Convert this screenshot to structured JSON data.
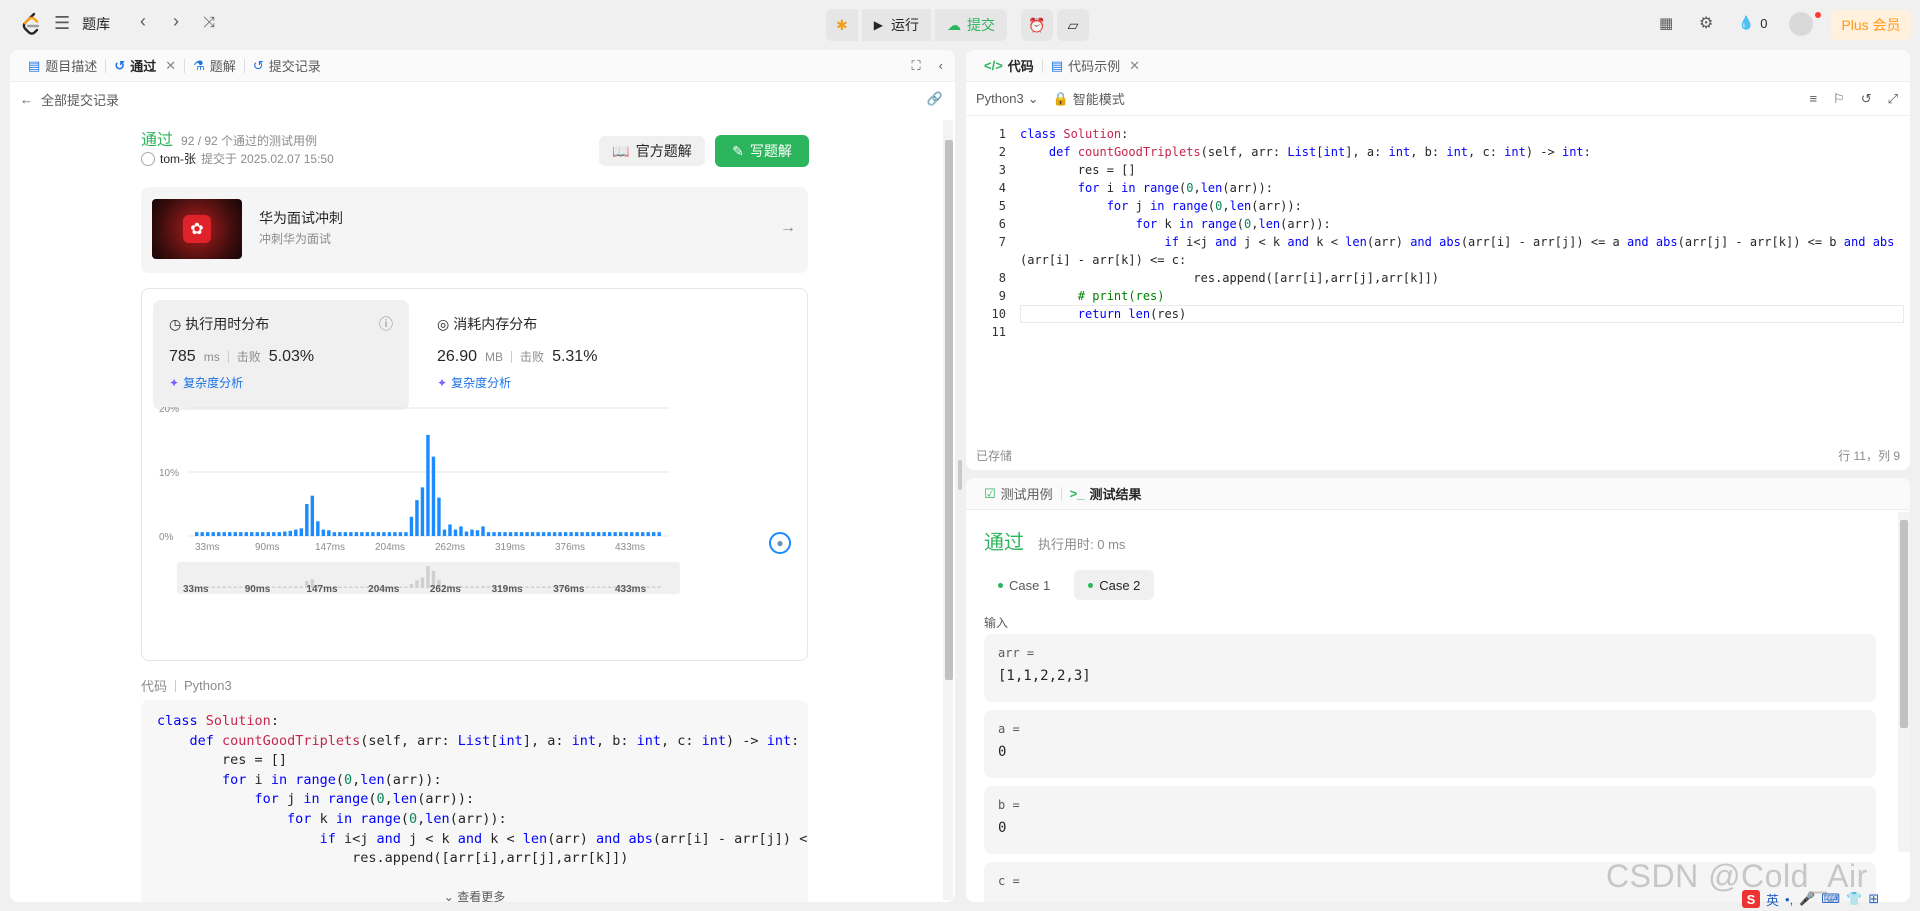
{
  "topnav": {
    "problem_bank": "题库",
    "run": "运行",
    "submit": "提交",
    "streak_count": "0",
    "plus": "Plus 会员"
  },
  "left_panel": {
    "tabs": [
      {
        "label": "题目描述"
      },
      {
        "label": "通过"
      },
      {
        "label": "题解"
      },
      {
        "label": "提交记录"
      }
    ],
    "back_label": "全部提交记录",
    "status": "通过",
    "testcases": "92 / 92 个通过的测试用例",
    "author": "tom-张",
    "submitted_at": "提交于 2025.02.07 15:50",
    "official_solution": "官方题解",
    "write_solution": "写题解",
    "promo": {
      "title": "华为面试冲刺",
      "subtitle": "冲刺华为面试",
      "logo_text": "HUAWEI"
    },
    "runtime": {
      "title": "执行用时分布",
      "value": "785",
      "unit": "ms",
      "beat_label": "击败",
      "beat": "5.03%",
      "link": "复杂度分析"
    },
    "memory": {
      "title": "消耗内存分布",
      "value": "26.90",
      "unit": "MB",
      "beat_label": "击败",
      "beat": "5.31%",
      "link": "复杂度分析"
    },
    "code_label": "代码",
    "code_lang": "Python3",
    "see_more": "查看更多",
    "code_lines": [
      "class Solution:",
      "    def countGoodTriplets(self, arr: List[int], a: int, b: int, c: int) -> int:",
      "        res = []",
      "        for i in range(0,len(arr)):",
      "            for j in range(0,len(arr)):",
      "                for k in range(0,len(arr)):",
      "                    if i<j and j < k and k < len(arr) and abs(arr[i] - arr[j]) <=",
      "                        res.append([arr[i],arr[j],arr[k]])"
    ]
  },
  "chart_data": {
    "type": "bar",
    "title": "执行用时分布",
    "xlabel": "",
    "ylabel": "",
    "ylim": [
      0,
      20
    ],
    "y_ticks": [
      "20%",
      "10%",
      "0%"
    ],
    "x_ticks": [
      "33ms",
      "90ms",
      "147ms",
      "204ms",
      "262ms",
      "319ms",
      "376ms",
      "433ms"
    ],
    "grid": true,
    "values": [
      0.6,
      0.6,
      0.6,
      0.6,
      0.6,
      0.6,
      0.6,
      0.6,
      0.6,
      0.6,
      0.6,
      0.6,
      0.6,
      0.6,
      0.6,
      0.6,
      0.7,
      0.8,
      1.0,
      1.2,
      5.0,
      6.3,
      2.3,
      1.0,
      0.9,
      0.6,
      0.6,
      0.6,
      0.6,
      0.6,
      0.6,
      0.6,
      0.6,
      0.6,
      0.6,
      0.6,
      0.6,
      0.6,
      0.6,
      3.0,
      5.6,
      7.6,
      15.8,
      12.4,
      6.0,
      1.0,
      1.8,
      1.0,
      1.5,
      0.7,
      1.0,
      0.9,
      1.5,
      0.6,
      0.6,
      0.6,
      0.6,
      0.6,
      0.6,
      0.6,
      0.6,
      0.6,
      0.6,
      0.6,
      0.6,
      0.6,
      0.6,
      0.6,
      0.6,
      0.6,
      0.6,
      0.6,
      0.6,
      0.6,
      0.6,
      0.6,
      0.6,
      0.6,
      0.6,
      0.6,
      0.6,
      0.6,
      0.6,
      0.6,
      0.6
    ],
    "minimap_x_ticks": [
      "33ms",
      "90ms",
      "147ms",
      "204ms",
      "262ms",
      "319ms",
      "376ms",
      "433ms"
    ],
    "bar_color": "#1a8cff"
  },
  "code_panel": {
    "tabs": [
      {
        "label": "代码"
      },
      {
        "label": "代码示例"
      }
    ],
    "language": "Python3",
    "mode": "智能模式",
    "saved": "已存储",
    "cursor": "行 11，列 9",
    "line_numbers": [
      "1",
      "2",
      "3",
      "4",
      "5",
      "6",
      "7",
      "",
      "8",
      "9",
      "10",
      "11"
    ],
    "lines": [
      "class Solution:",
      "    def countGoodTriplets(self, arr: List[int], a: int, b: int, c: int) -> int:",
      "        res = []",
      "        for i in range(0,len(arr)):",
      "            for j in range(0,len(arr)):",
      "                for k in range(0,len(arr)):",
      "                    if i<j and j < k and k < len(arr) and abs(arr[i] - arr[j]) <= a and abs(arr[j] - arr[k]) <= b and abs",
      "(arr[i] - arr[k]) <= c:",
      "                        res.append([arr[i],arr[j],arr[k]])",
      "        # print(res)",
      "        return len(res)",
      ""
    ]
  },
  "result_panel": {
    "tabs": [
      {
        "label": "测试用例"
      },
      {
        "label": "测试结果"
      }
    ],
    "status": "通过",
    "runtime": "执行用时: 0 ms",
    "cases": [
      {
        "label": "Case 1"
      },
      {
        "label": "Case 2"
      }
    ],
    "input_label": "输入",
    "inputs": [
      {
        "name": "arr =",
        "value": "[1,1,2,2,3]"
      },
      {
        "name": "a =",
        "value": "0"
      },
      {
        "name": "b =",
        "value": "0"
      },
      {
        "name": "c =",
        "value": ""
      }
    ]
  },
  "watermark": "CSDN @Cold_Air",
  "tray": {
    "ime": "英"
  }
}
